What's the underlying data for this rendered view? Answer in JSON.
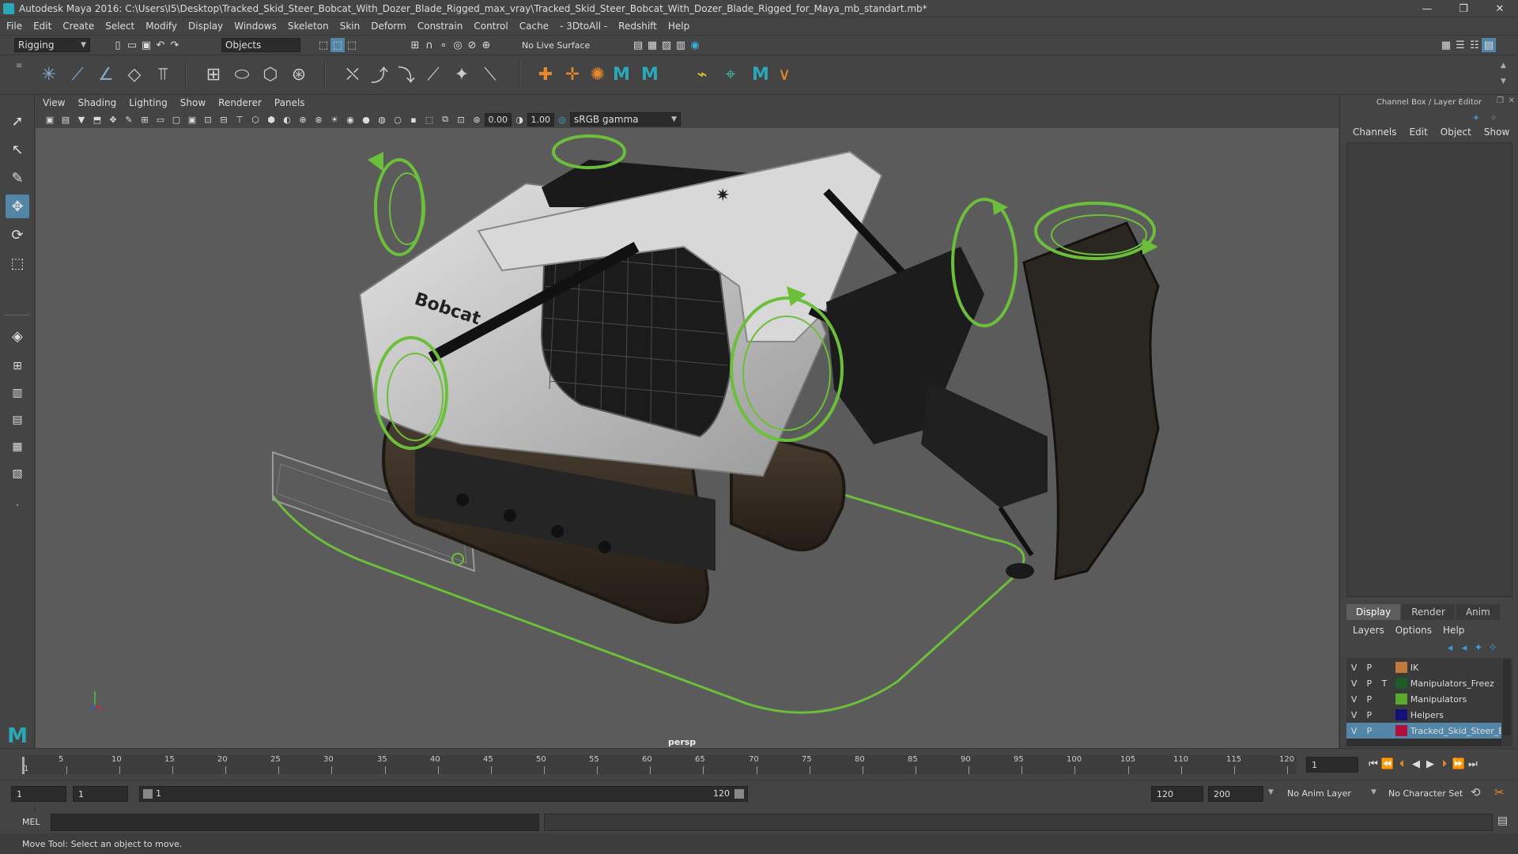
{
  "window": {
    "title": "Autodesk Maya 2016: C:\\Users\\I5\\Desktop\\Tracked_Skid_Steer_Bobcat_With_Dozer_Blade_Rigged_max_vray\\Tracked_Skid_Steer_Bobcat_With_Dozer_Blade_Rigged_for_Maya_mb_standart.mb*",
    "minimize": "—",
    "maximize": "❐",
    "close": "✕"
  },
  "menus": [
    "File",
    "Edit",
    "Create",
    "Select",
    "Modify",
    "Display",
    "Windows",
    "Skeleton",
    "Skin",
    "Deform",
    "Constrain",
    "Control",
    "Cache",
    "- 3DtoAll -",
    "Redshift",
    "Help"
  ],
  "statusline": {
    "mode": "Rigging",
    "selection_mode": "Objects",
    "live_surface": "No Live Surface"
  },
  "viewport": {
    "menus": [
      "View",
      "Shading",
      "Lighting",
      "Show",
      "Renderer",
      "Panels"
    ],
    "exposure": "0.00",
    "gamma": "1.00",
    "color_space": "sRGB gamma",
    "camera": "persp",
    "brand_text": "Bobcat"
  },
  "channel_box": {
    "title": "Channel Box / Layer Editor",
    "menus": [
      "Channels",
      "Edit",
      "Object",
      "Show"
    ],
    "tabs": [
      "Display",
      "Render",
      "Anim"
    ],
    "layer_menus": [
      "Layers",
      "Options",
      "Help"
    ],
    "layers": [
      {
        "v": "V",
        "p": "P",
        "t": "",
        "color": "#c07a3a",
        "name": "IK"
      },
      {
        "v": "V",
        "p": "P",
        "t": "T",
        "color": "#1f5a2a",
        "name": "Manipulators_Freez"
      },
      {
        "v": "V",
        "p": "P",
        "t": "",
        "color": "#5aa82e",
        "name": "Manipulators"
      },
      {
        "v": "V",
        "p": "P",
        "t": "",
        "color": "#12127a",
        "name": "Helpers"
      },
      {
        "v": "V",
        "p": "P",
        "t": "",
        "color": "#b0103a",
        "name": "Tracked_Skid_Steer_Bob"
      }
    ]
  },
  "timeline": {
    "ticks": [
      "5",
      "10",
      "15",
      "20",
      "25",
      "30",
      "35",
      "40",
      "45",
      "50",
      "55",
      "60",
      "65",
      "70",
      "75",
      "80",
      "85",
      "90",
      "95",
      "100",
      "105",
      "110",
      "115",
      "120"
    ],
    "start_label": "1",
    "current_frame": "1"
  },
  "range": {
    "start": "1",
    "playback_start": "1",
    "slider_start": "1",
    "slider_end": "120",
    "playback_end": "120",
    "end": "200",
    "anim_layer": "No Anim Layer",
    "character_set": "No Character Set"
  },
  "command": {
    "language": "MEL"
  },
  "help_line": "Move Tool: Select an object to move."
}
